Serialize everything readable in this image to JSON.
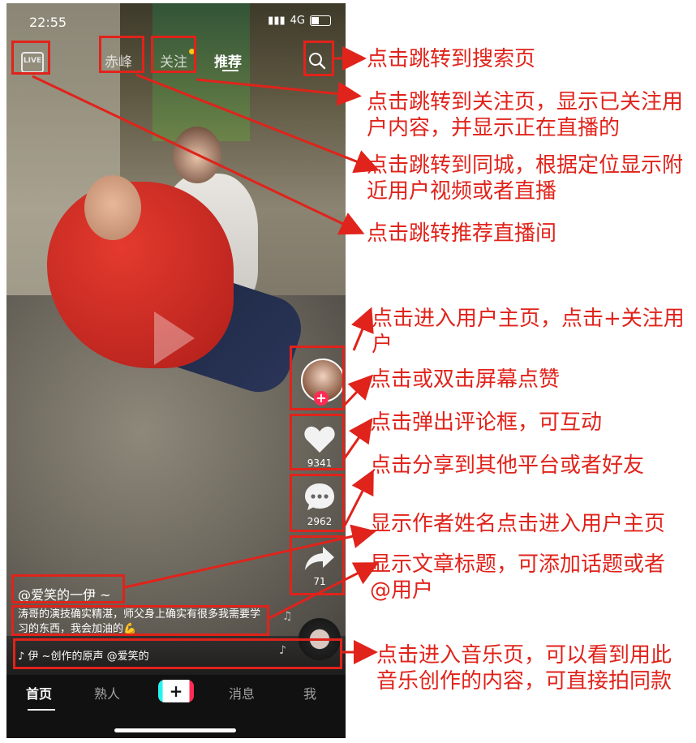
{
  "status_bar": {
    "time": "22:55",
    "network": "4G"
  },
  "top_bar": {
    "live_label": "LIVE",
    "tabs": [
      {
        "label": "赤峰"
      },
      {
        "label": "关注"
      },
      {
        "label": "推荐"
      }
    ]
  },
  "sidebar": {
    "like_count": "9341",
    "comment_count": "2962",
    "share_count": "71"
  },
  "video": {
    "author": "@爱笑的一伊 ~",
    "caption": "涛哥的演技确实精湛，师父身上确实有很多我需要学习的东西，我会加油的💪",
    "music": "♪ 伊 ~创作的原声   @爱笑的"
  },
  "bottom_nav": {
    "items": [
      {
        "label": "首页"
      },
      {
        "label": "熟人"
      },
      {
        "label": "+"
      },
      {
        "label": "消息"
      },
      {
        "label": "我"
      }
    ]
  },
  "annotations": [
    "点击跳转到搜索页",
    "点击跳转到关注页，显示已关注用户内容，并显示正在直播的",
    "点击跳转到同城，根据定位显示附近用户视频或者直播",
    "点击跳转推荐直播间",
    "点击进入用户主页，点击+关注用户",
    "点击或双击屏幕点赞",
    "点击弹出评论框，可互动",
    "点击分享到其他平台或者好友",
    "显示作者姓名点击进入用户主页",
    "显示文章标题，可添加话题或者@用户",
    "点击进入音乐页，可以看到用此音乐创作的内容，可直接拍同款"
  ],
  "colors": {
    "annotation_red": "#e0231b",
    "brand_pink": "#fe2c55",
    "brand_cyan": "#25f4ee"
  }
}
